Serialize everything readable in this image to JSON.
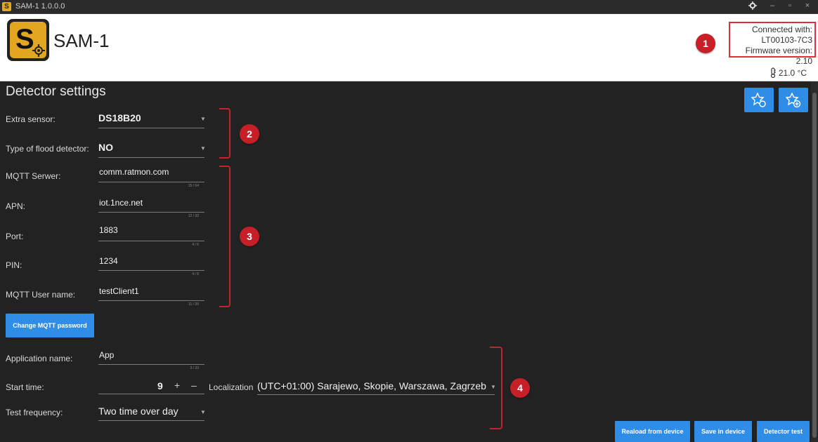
{
  "window": {
    "title": "SAM-1 1.0.0.0",
    "logo_letter": "S",
    "controls": {
      "settings_icon": "gear-icon",
      "minimize": "–",
      "maximize": "▫",
      "close": "×"
    }
  },
  "header": {
    "logo_letter": "S",
    "app_name": "SAM-1",
    "connection": {
      "line1": "Connected with:",
      "line2": "LT00103-7C3",
      "line3": "Firmware version: 2.10"
    },
    "badge_1": "1",
    "temperature": "21.0 °C"
  },
  "main": {
    "title": "Detector settings",
    "badges": {
      "b2": "2",
      "b3": "3",
      "b4": "4"
    },
    "extra_sensor": {
      "label": "Extra sensor:",
      "value": "DS18B20"
    },
    "flood_detector": {
      "label": "Type of flood detector:",
      "value": "NO"
    },
    "mqtt_server": {
      "label": "MQTT Serwer:",
      "value": "comm.ratmon.com",
      "counter": "15 / 64"
    },
    "apn": {
      "label": "APN:",
      "value": "iot.1nce.net",
      "counter": "12 / 32"
    },
    "port": {
      "label": "Port:",
      "value": "1883",
      "counter": "4 / 6"
    },
    "pin": {
      "label": "PIN:",
      "value": "1234",
      "counter": "4 / 8"
    },
    "mqtt_user": {
      "label": "MQTT User name:",
      "value": "testClient1",
      "counter": "11 / 20"
    },
    "change_password_button": "Change MQTT password",
    "app_name": {
      "label": "Application name:",
      "value": "App",
      "counter": "3 / 20"
    },
    "start_time": {
      "label": "Start time:",
      "value": "9",
      "plus": "+",
      "minus": "–"
    },
    "localization": {
      "label": "Localization",
      "value": "(UTC+01:00) Sarajewo, Skopie, Warszawa, Zagrzeb"
    },
    "test_frequency": {
      "label": "Test frequency:",
      "value": "Two time over day"
    },
    "buttons": {
      "reload": "Reaload from device",
      "save": "Save in device",
      "test": "Detector test"
    }
  },
  "colors": {
    "accent": "#2f8de8",
    "badge": "#c71f28",
    "background": "#222222",
    "logo": "#e2a621"
  }
}
